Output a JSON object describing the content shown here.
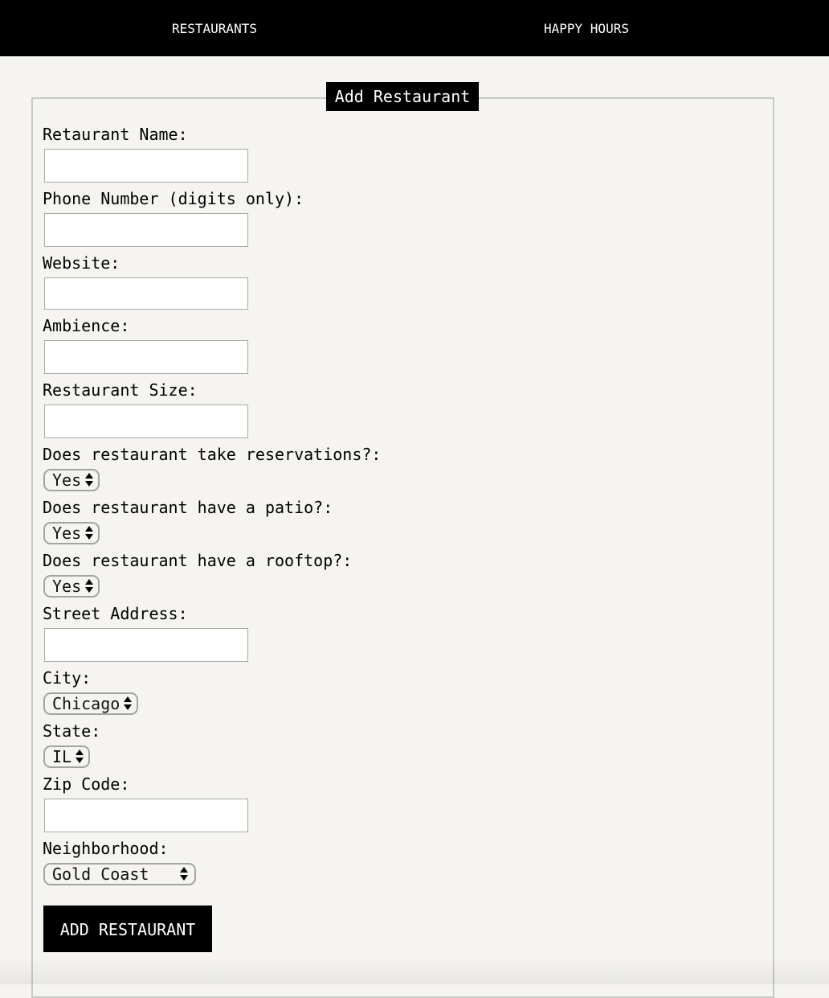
{
  "nav": {
    "restaurants": "RESTAURANTS",
    "happy_hours": "HAPPY HOURS"
  },
  "form": {
    "legend": "Add Restaurant",
    "restaurant_name_label": "Retaurant Name:",
    "restaurant_name_value": "",
    "phone_label": "Phone Number (digits only):",
    "phone_value": "",
    "website_label": "Website:",
    "website_value": "",
    "ambience_label": "Ambience:",
    "ambience_value": "",
    "size_label": "Restaurant Size:",
    "size_value": "",
    "reservations_label": "Does restaurant take reservations?:",
    "reservations_value": "Yes",
    "patio_label": "Does restaurant have a patio?:",
    "patio_value": "Yes",
    "rooftop_label": "Does restaurant have a rooftop?:",
    "rooftop_value": "Yes",
    "street_label": "Street Address:",
    "street_value": "",
    "city_label": "City:",
    "city_value": "Chicago",
    "state_label": "State:",
    "state_value": "IL",
    "zip_label": "Zip Code:",
    "zip_value": "",
    "neighborhood_label": "Neighborhood:",
    "neighborhood_value": "Gold Coast",
    "submit_label": "ADD RESTAURANT"
  }
}
